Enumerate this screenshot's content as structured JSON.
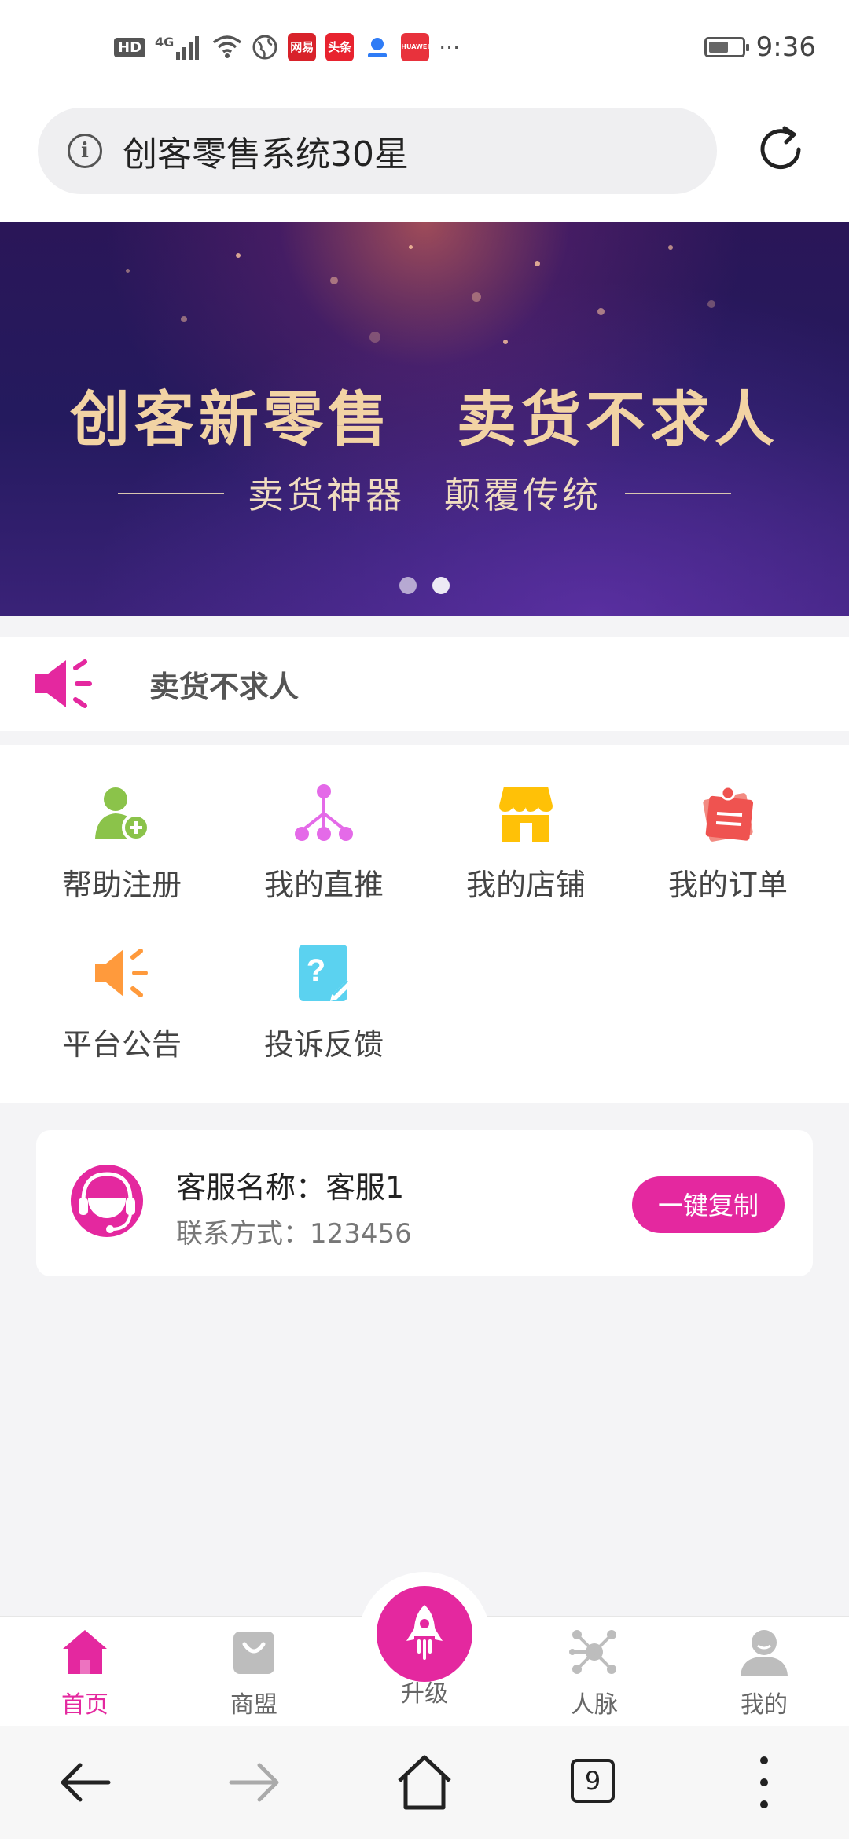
{
  "status_bar": {
    "left_icons": [
      "hd-icon",
      "4g-signal-icon",
      "wifi-icon",
      "browser-icon",
      "netease-icon",
      "toutiao-icon",
      "app-icon",
      "huawei-icon",
      "more-icon"
    ],
    "hd": "HD",
    "net": "4G",
    "chip_netease": "网易",
    "chip_toutiao": "头条",
    "chip_huawei": "HUAWEI",
    "more": "···",
    "time": "9:36"
  },
  "address_bar": {
    "info": "i",
    "title": "创客零售系统30星"
  },
  "banner": {
    "title": "创客新零售　卖货不求人",
    "subtitle": "卖货神器　颠覆传统",
    "slides": 2,
    "active_slide": 2
  },
  "notice": {
    "text": "卖货不求人"
  },
  "grid": {
    "items": [
      {
        "label": "帮助注册",
        "icon": "add-user-icon",
        "color": "#8bc34a"
      },
      {
        "label": "我的直推",
        "icon": "network-tree-icon",
        "color": "#e46ae8"
      },
      {
        "label": "我的店铺",
        "icon": "store-icon",
        "color": "#ffc107"
      },
      {
        "label": "我的订单",
        "icon": "order-note-icon",
        "color": "#ef5350"
      },
      {
        "label": "平台公告",
        "icon": "megaphone-icon",
        "color": "#ff9a3c"
      },
      {
        "label": "投诉反馈",
        "icon": "feedback-icon",
        "color": "#5bd2f0"
      }
    ]
  },
  "service": {
    "name": "客服名称：客服1",
    "contact": "联系方式：123456",
    "copy_button": "一键复制"
  },
  "tabbar": {
    "tabs": [
      {
        "label": "首页",
        "icon": "home-icon",
        "active": true
      },
      {
        "label": "商盟",
        "icon": "shopping-bag-icon",
        "active": false
      },
      {
        "label": "升级",
        "icon": "rocket-icon",
        "active": false
      },
      {
        "label": "人脉",
        "icon": "network-icon",
        "active": false
      },
      {
        "label": "我的",
        "icon": "user-icon",
        "active": false
      }
    ]
  },
  "system_nav": {
    "tab_count": "9"
  },
  "colors": {
    "accent": "#e4289f",
    "banner_text": "#f2d3a4"
  }
}
